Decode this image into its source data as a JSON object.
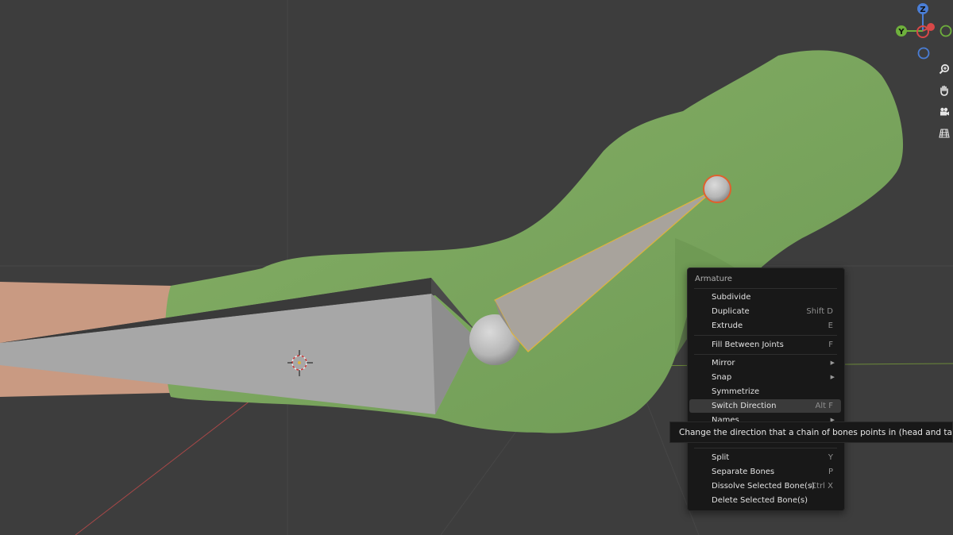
{
  "navigation_gizmo": {
    "axis_z_label": "Z",
    "axis_y_label": "Y",
    "tools": [
      {
        "icon": "zoom-icon"
      },
      {
        "icon": "hand-pan-icon"
      },
      {
        "icon": "camera-icon"
      },
      {
        "icon": "grid-ortho-icon"
      }
    ]
  },
  "context_menu": {
    "title": "Armature",
    "items": {
      "subdivide": {
        "label": "Subdivide",
        "shortcut": ""
      },
      "duplicate": {
        "label": "Duplicate",
        "shortcut": "Shift D"
      },
      "extrude": {
        "label": "Extrude",
        "shortcut": "E"
      },
      "fill": {
        "label": "Fill Between Joints",
        "shortcut": "F"
      },
      "mirror": {
        "label": "Mirror",
        "submenu": true
      },
      "snap": {
        "label": "Snap",
        "submenu": true
      },
      "symmetrize": {
        "label": "Symmetrize",
        "shortcut": ""
      },
      "switch_direction": {
        "label": "Switch Direction",
        "shortcut": "Alt F",
        "highlighted": true
      },
      "names": {
        "label": "Names",
        "submenu": true
      },
      "split": {
        "label": "Split",
        "shortcut": "Y"
      },
      "separate": {
        "label": "Separate Bones",
        "shortcut": "P"
      },
      "dissolve": {
        "label": "Dissolve Selected Bone(s)",
        "shortcut": "Ctrl X"
      },
      "delete": {
        "label": "Delete Selected Bone(s)",
        "shortcut": ""
      }
    }
  },
  "tooltip": {
    "text": "Change the direction that a chain of bones points in (head and tail swap)."
  },
  "colors": {
    "viewport_bg": "#3d3d3d",
    "mesh_green": "#7fa862",
    "skin": "#c99a82",
    "bone_gray": "#a8a8a8",
    "selection_yellow": "#e0b43a",
    "menu_bg": "#181818",
    "menu_highlight": "#3a3a3a"
  }
}
